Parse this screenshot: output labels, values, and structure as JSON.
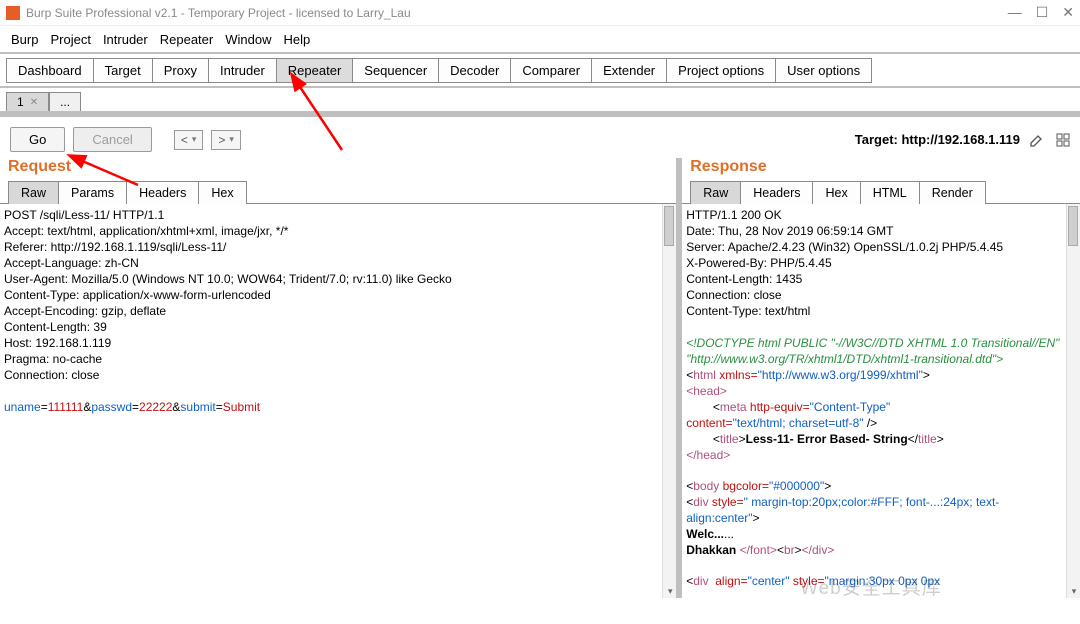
{
  "title": "Burp Suite Professional v2.1 - Temporary Project - licensed to Larry_Lau",
  "menu": [
    "Burp",
    "Project",
    "Intruder",
    "Repeater",
    "Window",
    "Help"
  ],
  "maintabs": [
    "Dashboard",
    "Target",
    "Proxy",
    "Intruder",
    "Repeater",
    "Sequencer",
    "Decoder",
    "Comparer",
    "Extender",
    "Project options",
    "User options"
  ],
  "active_maintab": 4,
  "subtab1": "1",
  "subtab2": "...",
  "btn_go": "Go",
  "btn_cancel": "Cancel",
  "target_label": "Target: ",
  "target_value": "http://192.168.1.119",
  "request_title": "Request",
  "response_title": "Response",
  "req_tabs": [
    "Raw",
    "Params",
    "Headers",
    "Hex"
  ],
  "rsp_tabs": [
    "Raw",
    "Headers",
    "Hex",
    "HTML",
    "Render"
  ],
  "req_active_tab": 0,
  "rsp_active_tab": 0,
  "request_headers": "POST /sqli/Less-11/ HTTP/1.1\nAccept: text/html, application/xhtml+xml, image/jxr, */*\nReferer: http://192.168.1.119/sqli/Less-11/\nAccept-Language: zh-CN\nUser-Agent: Mozilla/5.0 (Windows NT 10.0; WOW64; Trident/7.0; rv:11.0) like Gecko\nContent-Type: application/x-www-form-urlencoded\nAccept-Encoding: gzip, deflate\nContent-Length: 39\nHost: 192.168.1.119\nPragma: no-cache\nConnection: close\n\n",
  "req_form": {
    "k1": "uname",
    "v1": "111111",
    "k2": "passwd",
    "v2": "22222",
    "k3": "submit",
    "v3": "Submit"
  },
  "response_headers": "HTTP/1.1 200 OK\nDate: Thu, 28 Nov 2019 06:59:14 GMT\nServer: Apache/2.4.23 (Win32) OpenSSL/1.0.2j PHP/5.4.45\nX-Powered-By: PHP/5.4.45\nContent-Length: 1435\nConnection: close\nContent-Type: text/html\n\n",
  "doctype_comment": "<!DOCTYPE html PUBLIC \"-//W3C//DTD XHTML 1.0 Transitional//EN\" \"http://www.w3.org/TR/xhtml1/DTD/xhtml1-transitional.dtd\">",
  "html_open1": "<",
  "html_open_tag": "html",
  "html_xmlns_attr": " xmlns=",
  "html_xmlns_val": "\"http://www.w3.org/1999/xhtml\"",
  "html_open2": ">",
  "head_open": "<head>",
  "meta_l": "        <",
  "meta_tag": "meta",
  "meta_attr": " http-equiv=",
  "meta_val": "\"Content-Type\"",
  "meta2_attr": "content=",
  "meta2_val": "\"text/html; charset=utf-8\"",
  "meta_close": " />",
  "title_l": "        <",
  "title_tag": "title",
  "title_l2": ">",
  "title_text": "Less-11- Error Based- String",
  "title_c": "</",
  "title_c2": ">",
  "head_close": "</head>",
  "body_l": "<",
  "body_tag": "body",
  "body_attr": " bgcolor=",
  "body_val": "\"#000000\"",
  "body_l2": ">",
  "div1_l": "<",
  "div1_tag": "div",
  "div1_attr": " style=",
  "div1_val": "\" margin-top:20px;color:#FFF; font-...:24px; text-align:center\"",
  "div1_l2": ">",
  "welcome_pre": "Welc...",
  "welcome_post": "...",
  "dhakkan_pre": "Dhakkan ",
  "dhakkan_tag1": "</font>",
  "dhakkan_tag2_l": "<",
  "dhakkan_tag2": "br",
  "dhakkan_tag2_c": ">",
  "dhakkan_tag3": "</div>",
  "div2_l": "<",
  "div2_tag": "div",
  "div2_attr": "  align=",
  "div2_val": "\"center\"",
  "div2_attr2": " style=",
  "div2_val2": "\"margin:30px 0px 0px",
  "watermark": "Web安全工具库"
}
